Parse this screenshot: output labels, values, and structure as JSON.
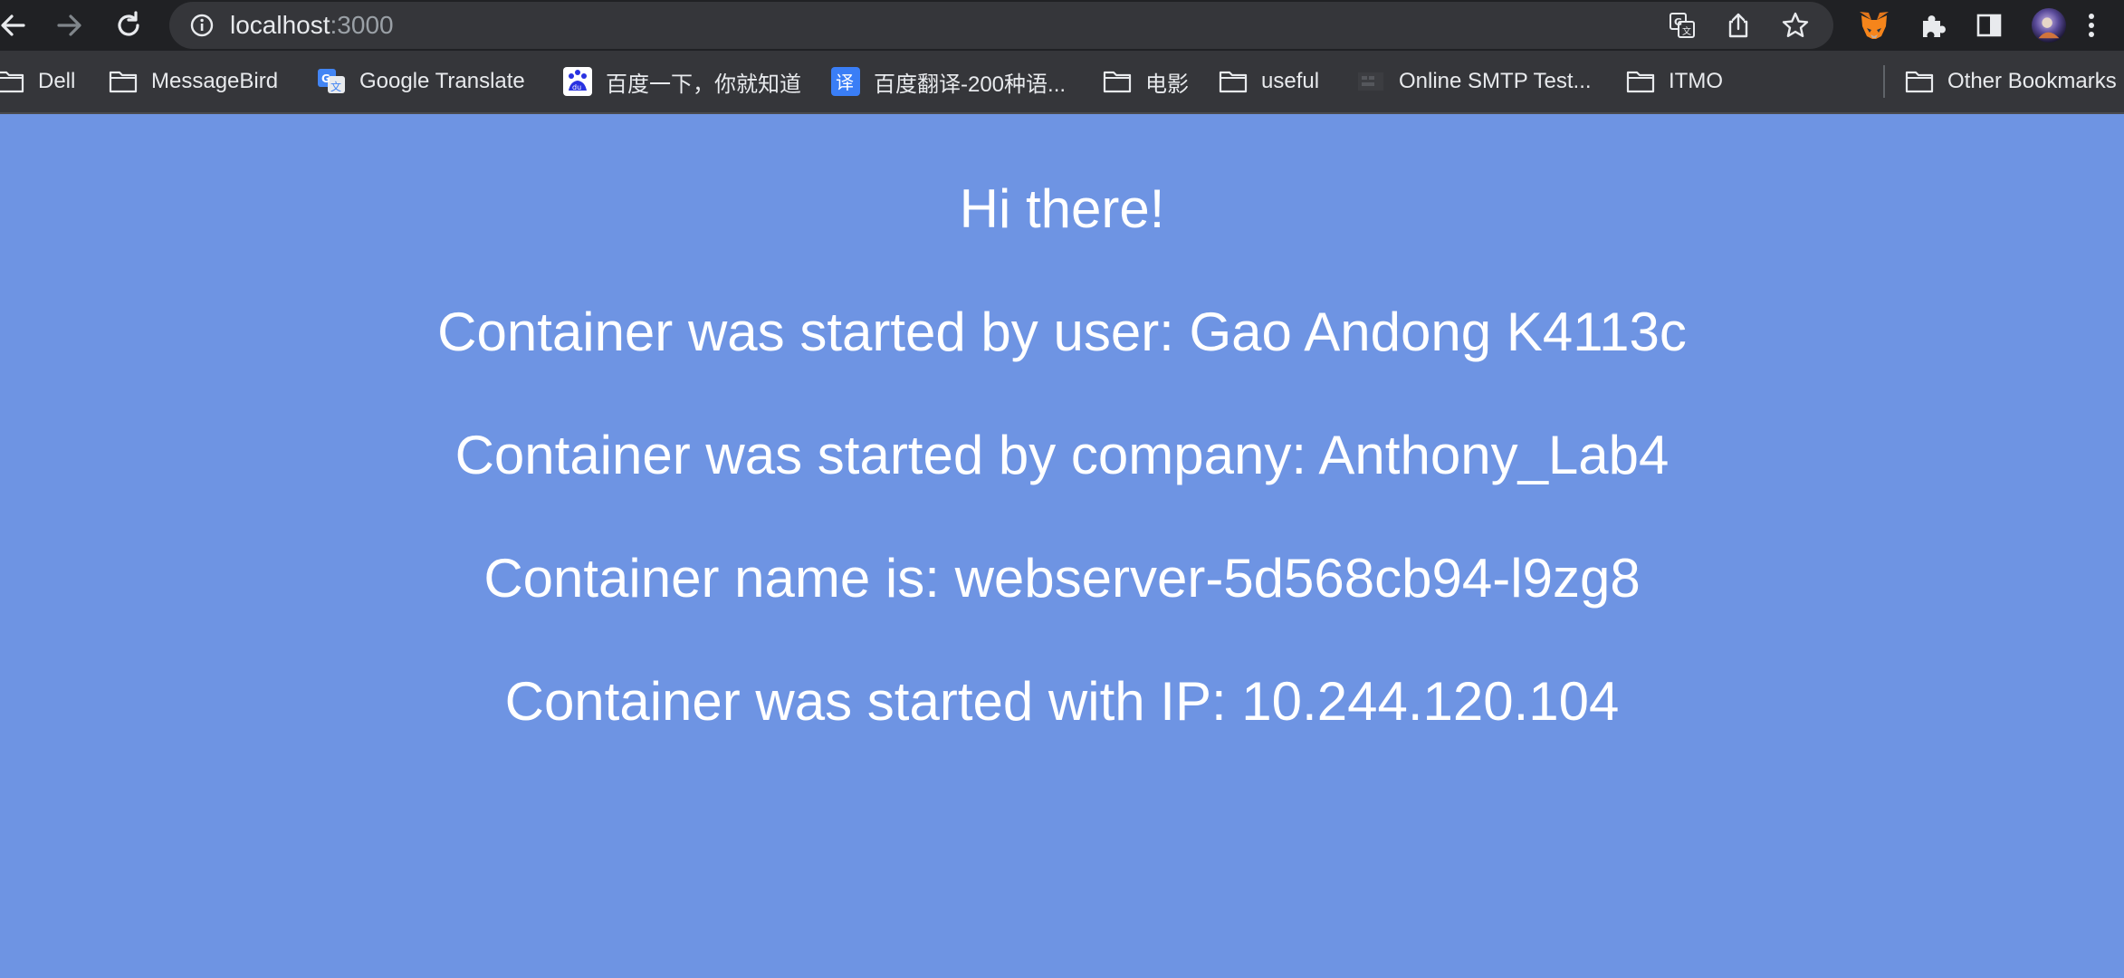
{
  "browser": {
    "address_bar": {
      "host": "localhost",
      "port": ":3000"
    }
  },
  "bookmarks": [
    {
      "label": "Dell",
      "icon": "folder-icon"
    },
    {
      "label": "MessageBird",
      "icon": "folder-icon"
    },
    {
      "label": "Google Translate",
      "icon": "google-translate-icon"
    },
    {
      "label": "百度一下，你就知道",
      "icon": "baidu-icon"
    },
    {
      "label": "百度翻译-200种语...",
      "icon": "baidu-translate-icon"
    },
    {
      "label": "电影",
      "icon": "folder-icon"
    },
    {
      "label": "useful",
      "icon": "folder-icon"
    },
    {
      "label": "Online SMTP Test...",
      "icon": "smtp-site-icon"
    },
    {
      "label": "ITMO",
      "icon": "folder-icon"
    },
    {
      "label": "Other Bookmarks",
      "icon": "folder-icon"
    }
  ],
  "content": {
    "greeting": "Hi there!",
    "user_line": "Container was started by user: Gao Andong K4113c",
    "company_line": "Container was started by company: Anthony_Lab4",
    "name_line": "Container name is: webserver-5d568cb94-l9zg8",
    "ip_line": "Container was started with IP: 10.244.120.104"
  },
  "colors": {
    "page_background": "#6e94e3",
    "toolbar": "#202124",
    "bookmarks_bar": "#35363a",
    "text": "#ffffff"
  }
}
